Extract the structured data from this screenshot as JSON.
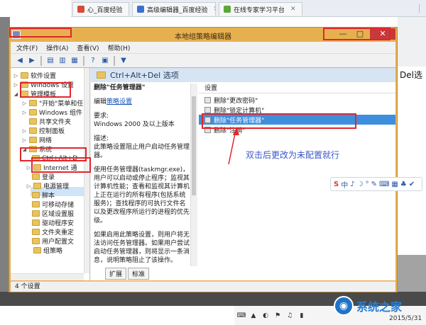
{
  "browser": {
    "tabs": [
      {
        "label": "心_百度经验",
        "color": "#d84a38"
      },
      {
        "label": "高级编辑器_百度经验",
        "color": "#3b6fd0"
      },
      {
        "label": "在线专家学习平台",
        "color": "#5aa839"
      }
    ],
    "background_text": "Del选"
  },
  "window": {
    "title": "本地组策略编辑器",
    "controls": {
      "minimize": "—",
      "maximize": "□",
      "close": "✕"
    },
    "menu": [
      "文件(F)",
      "操作(A)",
      "查看(V)",
      "帮助(H)"
    ]
  },
  "tree": {
    "items": [
      {
        "label": "软件设置",
        "arrow": "▷"
      },
      {
        "label": "Windows 设置",
        "arrow": "▷"
      },
      {
        "label": "管理模板",
        "arrow": "◢"
      },
      {
        "label": "\"开始\"菜单和任",
        "arrow": "▷"
      },
      {
        "label": "Windows 组件",
        "arrow": "▷"
      },
      {
        "label": "共享文件夹",
        "arrow": ""
      },
      {
        "label": "控制面板",
        "arrow": "▷"
      },
      {
        "label": "网络",
        "arrow": "▷"
      },
      {
        "label": "系统",
        "arrow": "◢"
      },
      {
        "label": "Ctrl+Alt+D",
        "arrow": ""
      },
      {
        "label": "Internet 通",
        "arrow": "▷"
      },
      {
        "label": "登录",
        "arrow": ""
      },
      {
        "label": "电源管理",
        "arrow": "▷"
      },
      {
        "label": "脚本",
        "arrow": ""
      },
      {
        "label": "可移动存储",
        "arrow": ""
      },
      {
        "label": "区域设置服",
        "arrow": ""
      },
      {
        "label": "驱动程序安",
        "arrow": ""
      },
      {
        "label": "文件夹重定",
        "arrow": ""
      },
      {
        "label": "用户配置文",
        "arrow": ""
      },
      {
        "label": "组策略",
        "arrow": ""
      }
    ]
  },
  "content": {
    "header": "Ctrl+Alt+Del 选项",
    "desc": {
      "title": "删除\"任务管理器\"",
      "edit_prefix": "编辑",
      "edit_link": "策略设置",
      "req_label": "要求:",
      "req_value": "Windows 2000 及以上版本",
      "desc_label": "描述:",
      "desc_value": "此策略设置阻止用户启动任务管理器。",
      "para2": "使用任务管理器(taskmgr.exe)，用户可以启动或停止程序；监视其计算机性能；查看和监视其计算机上正在运行的所有程序(包括系统服务)；查找程序的可执行文件名以及更改程序所运行的进程的优先级。",
      "para3": "如果启用此策略设置，则用户将无法访问任务管理器。如果用户尝试启动任务管理器，则将显示一条消息，说明策略阻止了该操作。"
    },
    "list_header": "设置",
    "list": [
      {
        "label": "删除\"更改密码\""
      },
      {
        "label": "删除\"锁定计算机\""
      },
      {
        "label": "删除\"任务管理器\"",
        "selected": true
      },
      {
        "label": "删除\"注销\""
      }
    ],
    "tabs": [
      "扩展",
      "标准"
    ]
  },
  "status": "4 个设置",
  "annotation": "双击后更改为未配置就行",
  "ime": {
    "logo": "S",
    "symbols": [
      "中",
      "♪",
      "☽",
      "°",
      "✎",
      "⌨",
      "▦",
      "♣",
      "✔"
    ]
  },
  "taskbar": {
    "date": "2015/5/31",
    "watermark": "系统之家"
  }
}
